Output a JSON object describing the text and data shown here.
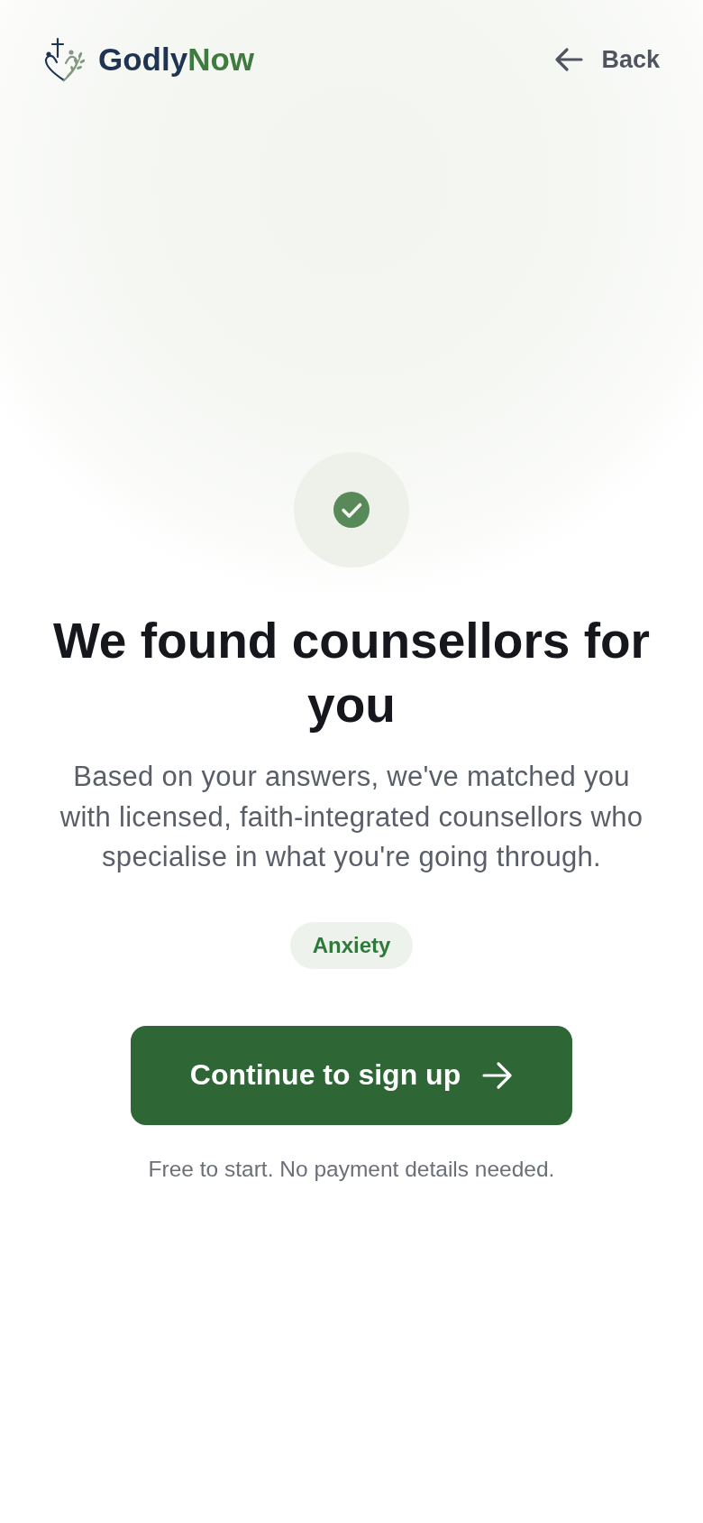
{
  "header": {
    "logo": {
      "brand": "Godly",
      "accent": "Now"
    },
    "back_button": {
      "label": "Back"
    }
  },
  "heading": "We found counsellors for you",
  "description": "Based on your answers, we've matched you with licensed, faith-integrated counsellors who specialise in what you're going through.",
  "tags": [
    {
      "label": "Anxiety"
    }
  ],
  "primary_button": {
    "label": "Continue to sign up"
  },
  "footnote": "Free to start. No payment details needed."
}
